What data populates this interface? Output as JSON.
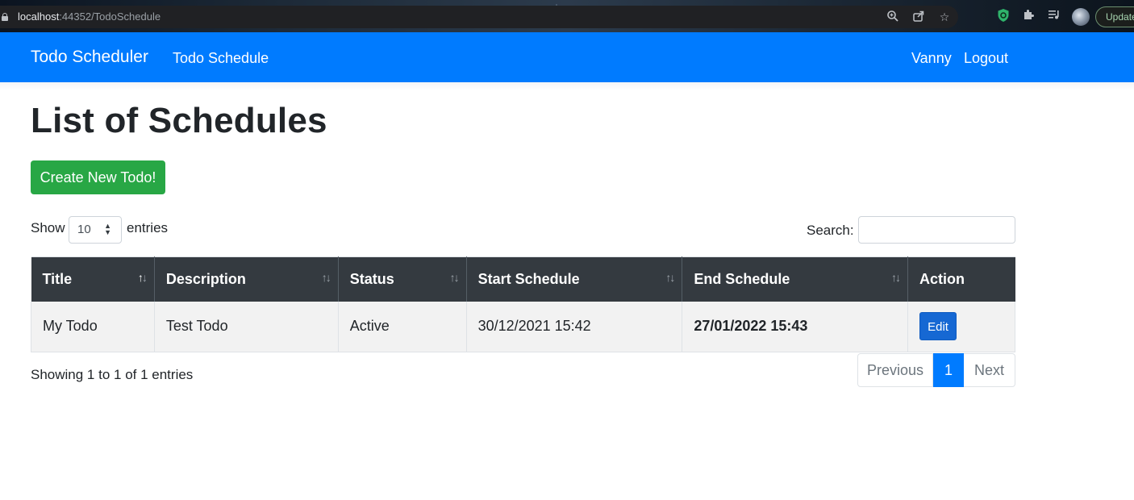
{
  "browser": {
    "url_host": "localhost",
    "url_rest": ":44352/TodoSchedule",
    "update_label": "Update"
  },
  "navbar": {
    "brand": "Todo Scheduler",
    "link_schedule": "Todo Schedule",
    "user": "Vanny",
    "logout": "Logout"
  },
  "page": {
    "title": "List of Schedules",
    "create_button": "Create New Todo!"
  },
  "controls": {
    "show_label": "Show",
    "entries_label": "entries",
    "page_size": "10",
    "search_label": "Search:",
    "search_value": ""
  },
  "table": {
    "headers": [
      "Title",
      "Description",
      "Status",
      "Start Schedule",
      "End Schedule",
      "Action"
    ],
    "rows": [
      {
        "title": "My Todo",
        "description": "Test Todo",
        "status": "Active",
        "start": "30/12/2021 15:42",
        "end": "27/01/2022 15:43",
        "action": "Edit"
      }
    ]
  },
  "footer": {
    "info": "Showing 1 to 1 of 1 entries",
    "previous": "Previous",
    "current_page": "1",
    "next": "Next"
  }
}
